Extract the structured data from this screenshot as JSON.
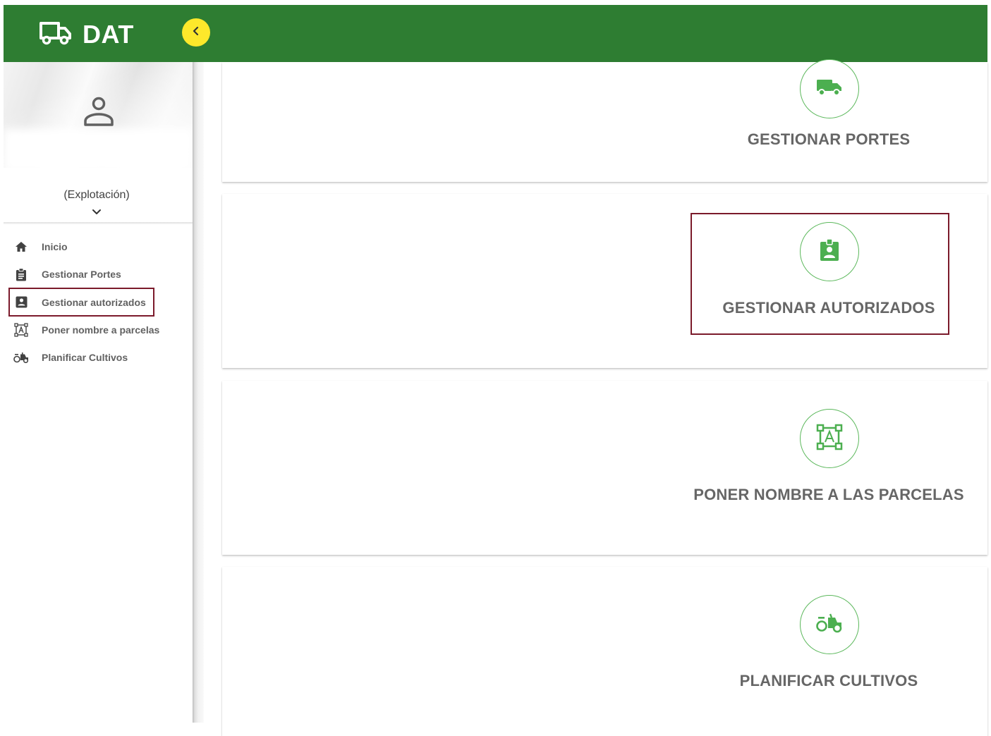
{
  "header": {
    "brand": "DAT",
    "brand_icon": "truck-icon",
    "collapse_icon": "chevron-left-icon",
    "bg_color": "#2e7d32",
    "collapse_color": "#fde82b"
  },
  "sidebar": {
    "farm_label": "(Explotación)",
    "items": [
      {
        "label": "Inicio",
        "icon": "home-icon"
      },
      {
        "label": "Gestionar Portes",
        "icon": "clipboard-icon"
      },
      {
        "label": "Gestionar autorizados",
        "icon": "account-box-icon"
      },
      {
        "label": "Poner nombre a parcelas",
        "icon": "text-frame-icon"
      },
      {
        "label": "Planificar Cultivos",
        "icon": "tractor-icon"
      }
    ]
  },
  "cards": [
    {
      "title": "GESTIONAR PORTES",
      "icon": "truck-icon"
    },
    {
      "title": "GESTIONAR AUTORIZADOS",
      "icon": "badge-account-icon"
    },
    {
      "title": "PONER NOMBRE A LAS PARCELAS",
      "icon": "text-frame-icon"
    },
    {
      "title": "PLANIFICAR CULTIVOS",
      "icon": "tractor-icon"
    }
  ],
  "colors": {
    "accent_green": "#4caf50",
    "highlight_red": "#7b1a2b"
  }
}
